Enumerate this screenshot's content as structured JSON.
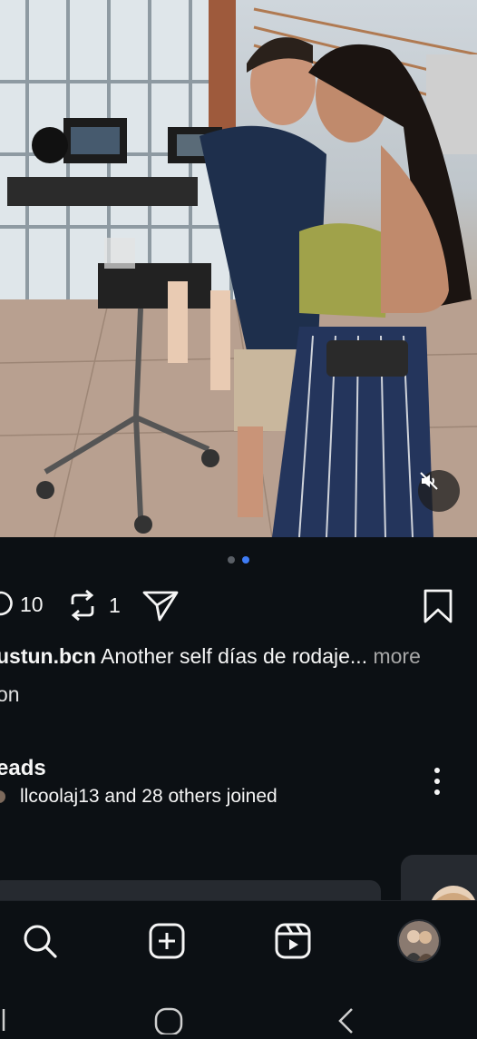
{
  "post": {
    "carousel": {
      "total": 2,
      "active_index": 1
    },
    "comments_count": "10",
    "reposts_count": "1",
    "caption_user": "ustun.bcn",
    "caption_text": " Another self días de rodaje...",
    "caption_more": " more",
    "caption_line2": "on"
  },
  "threads": {
    "title": "eads",
    "subtitle": "llcoolaj13 and 28 others joined"
  },
  "nav": {
    "items": [
      {
        "name": "search",
        "icon": "search-icon"
      },
      {
        "name": "create",
        "icon": "plus-square-icon"
      },
      {
        "name": "reels",
        "icon": "reels-icon"
      },
      {
        "name": "profile",
        "icon": "avatar"
      }
    ]
  },
  "colors": {
    "background": "#0c1014",
    "text": "#f5f5f5",
    "muted": "#a8a8a8",
    "accent": "#3f7cf5"
  }
}
